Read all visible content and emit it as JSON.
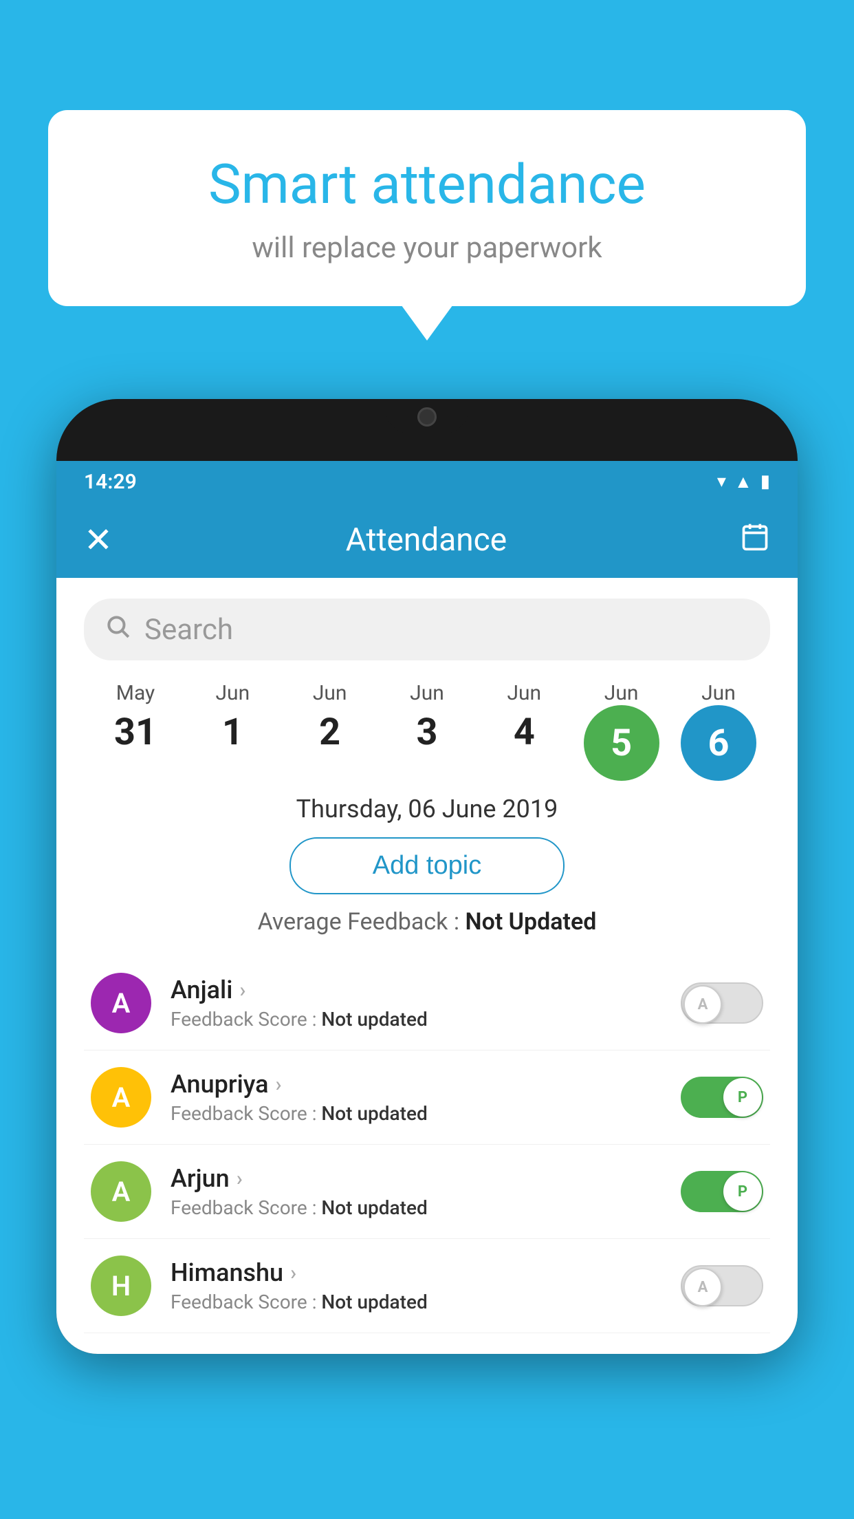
{
  "background_color": "#29b6e8",
  "bubble": {
    "title": "Smart attendance",
    "subtitle": "will replace your paperwork"
  },
  "status_bar": {
    "time": "14:29",
    "icons": [
      "wifi",
      "signal",
      "battery"
    ]
  },
  "app_header": {
    "title": "Attendance",
    "close_label": "✕",
    "calendar_icon": "📅"
  },
  "search": {
    "placeholder": "Search"
  },
  "calendar": {
    "days": [
      {
        "month": "May",
        "date": "31",
        "circle": false
      },
      {
        "month": "Jun",
        "date": "1",
        "circle": false
      },
      {
        "month": "Jun",
        "date": "2",
        "circle": false
      },
      {
        "month": "Jun",
        "date": "3",
        "circle": false
      },
      {
        "month": "Jun",
        "date": "4",
        "circle": false
      },
      {
        "month": "Jun",
        "date": "5",
        "circle": "green"
      },
      {
        "month": "Jun",
        "date": "6",
        "circle": "blue"
      }
    ]
  },
  "selected_date": "Thursday, 06 June 2019",
  "add_topic_label": "Add topic",
  "avg_feedback": {
    "label": "Average Feedback : ",
    "value": "Not Updated"
  },
  "students": [
    {
      "name": "Anjali",
      "avatar_letter": "A",
      "avatar_class": "avatar-purple",
      "feedback": "Feedback Score : ",
      "feedback_value": "Not updated",
      "toggle": "off",
      "toggle_letter": "A"
    },
    {
      "name": "Anupriya",
      "avatar_letter": "A",
      "avatar_class": "avatar-yellow",
      "feedback": "Feedback Score : ",
      "feedback_value": "Not updated",
      "toggle": "on",
      "toggle_letter": "P"
    },
    {
      "name": "Arjun",
      "avatar_letter": "A",
      "avatar_class": "avatar-green-light",
      "feedback": "Feedback Score : ",
      "feedback_value": "Not updated",
      "toggle": "on",
      "toggle_letter": "P"
    },
    {
      "name": "Himanshu",
      "avatar_letter": "H",
      "avatar_class": "avatar-green-light",
      "feedback": "Feedback Score : ",
      "feedback_value": "Not updated",
      "toggle": "off",
      "toggle_letter": "A"
    }
  ]
}
